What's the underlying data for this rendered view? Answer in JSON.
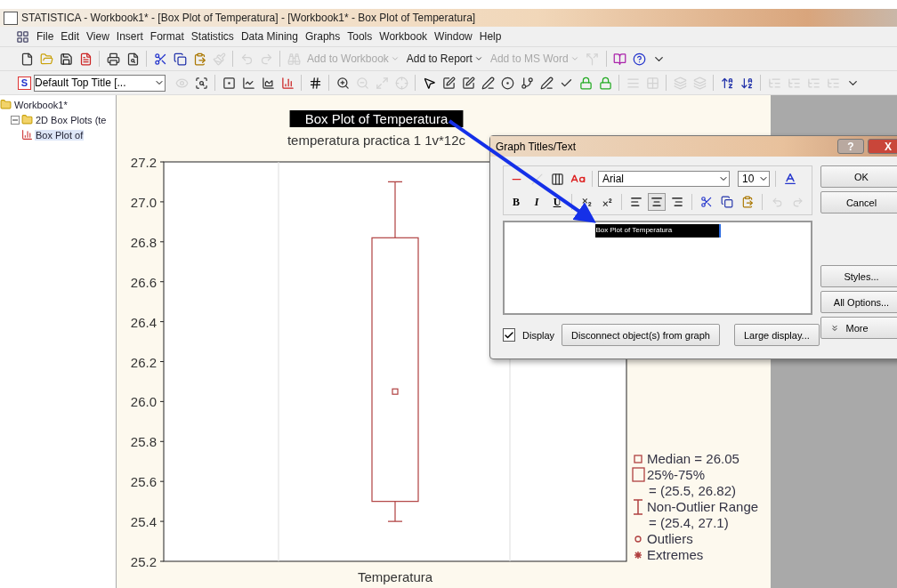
{
  "window": {
    "title": "STATISTICA - Workbook1* - [Box Plot of Temperatura] - [Workbook1* - Box Plot of Temperatura]"
  },
  "menu": [
    "File",
    "Edit",
    "View",
    "Insert",
    "Format",
    "Statistics",
    "Data Mining",
    "Graphs",
    "Tools",
    "Workbook",
    "Window",
    "Help"
  ],
  "toolbar_1": [
    {
      "kind": "new",
      "disabled": false
    },
    {
      "kind": "open",
      "disabled": false
    },
    {
      "kind": "save",
      "disabled": false
    },
    {
      "kind": "pdf",
      "disabled": false
    },
    {
      "kind": "separator"
    },
    {
      "kind": "print",
      "disabled": false
    },
    {
      "kind": "preview",
      "disabled": false
    },
    {
      "kind": "separator"
    },
    {
      "kind": "cut",
      "disabled": false
    },
    {
      "kind": "copy",
      "disabled": false
    },
    {
      "kind": "paste",
      "disabled": false
    },
    {
      "kind": "brush",
      "disabled": true
    },
    {
      "kind": "separator"
    },
    {
      "kind": "undo",
      "disabled": true
    },
    {
      "kind": "redo",
      "disabled": true
    },
    {
      "kind": "separator"
    },
    {
      "kind": "binoculars",
      "disabled": true
    },
    {
      "kind": "text",
      "label": "Add to Workbook",
      "disabled": true
    },
    {
      "kind": "text",
      "label": "Add to Report",
      "disabled": false
    },
    {
      "kind": "text",
      "label": "Add to MS Word",
      "disabled": true
    },
    {
      "kind": "fork",
      "disabled": true
    },
    {
      "kind": "separator"
    },
    {
      "kind": "book",
      "disabled": false
    },
    {
      "kind": "help",
      "disabled": false
    },
    {
      "kind": "more",
      "disabled": false
    }
  ],
  "toolbar_2": [
    {
      "kind": "select",
      "badge": "S",
      "value": "Default Top Title [...",
      "disabled": false
    },
    {
      "kind": "eye",
      "disabled": true
    },
    {
      "kind": "zoom-frame",
      "disabled": false
    },
    {
      "kind": "separator"
    },
    {
      "kind": "box",
      "disabled": false
    },
    {
      "kind": "chart-line",
      "disabled": false
    },
    {
      "kind": "chart-area",
      "disabled": false
    },
    {
      "kind": "chart-bar",
      "disabled": false
    },
    {
      "kind": "separator"
    },
    {
      "kind": "grid",
      "disabled": false
    },
    {
      "kind": "separator"
    },
    {
      "kind": "zoom-in",
      "disabled": false
    },
    {
      "kind": "zoom-out",
      "disabled": true
    },
    {
      "kind": "resize",
      "disabled": true
    },
    {
      "kind": "crosshair",
      "disabled": true
    },
    {
      "kind": "separator"
    },
    {
      "kind": "pointer",
      "disabled": false
    },
    {
      "kind": "edit",
      "disabled": false
    },
    {
      "kind": "edit",
      "disabled": false
    },
    {
      "kind": "pen",
      "disabled": false
    },
    {
      "kind": "circle-pen",
      "disabled": false
    },
    {
      "kind": "branch",
      "disabled": false
    },
    {
      "kind": "pen",
      "disabled": false
    },
    {
      "kind": "check",
      "disabled": false
    },
    {
      "kind": "lock",
      "disabled": false
    },
    {
      "kind": "lock",
      "disabled": false
    },
    {
      "kind": "separator"
    },
    {
      "kind": "lines",
      "disabled": true
    },
    {
      "kind": "pattern",
      "disabled": true
    },
    {
      "kind": "separator"
    },
    {
      "kind": "layers",
      "disabled": true
    },
    {
      "kind": "layers",
      "disabled": true
    },
    {
      "kind": "separator"
    },
    {
      "kind": "font-up",
      "disabled": false
    },
    {
      "kind": "font-down",
      "disabled": false
    },
    {
      "kind": "separator"
    },
    {
      "kind": "indent",
      "disabled": true
    },
    {
      "kind": "indent",
      "disabled": true
    },
    {
      "kind": "indent",
      "disabled": true
    },
    {
      "kind": "indent",
      "disabled": true
    },
    {
      "kind": "more",
      "disabled": false
    }
  ],
  "tree": [
    {
      "label": "Workbook1*",
      "children": [
        {
          "label": "2D Box Plots (te",
          "expanded": true,
          "children": [
            {
              "label": "Box Plot of",
              "selected": true
            }
          ]
        }
      ]
    }
  ],
  "graph": {
    "title": {
      "text": "Box Plot of Temperatura",
      "selected": true
    },
    "subtitle": "temperatura practica 1 1v*12c",
    "y_ticks": [
      "27.2",
      "27.0",
      "26.8",
      "26.6",
      "26.4",
      "26.2",
      "26.0",
      "25.8",
      "25.6",
      "25.4",
      "25.2"
    ],
    "category": "Temperatura",
    "legend": [
      {
        "kind": "median",
        "label": "Median = 26.05"
      },
      {
        "kind": "box",
        "label": "25%-75%",
        "detail": "= (25.5, 26.82)"
      },
      {
        "kind": "whisker",
        "label": "Non-Outlier Range",
        "detail": "= (25.4, 27.1)"
      },
      {
        "kind": "outlier",
        "label": "Outliers"
      },
      {
        "kind": "extreme",
        "label": "Extremes"
      }
    ]
  },
  "dialog": {
    "title": "Graph Titles/Text",
    "help": "?",
    "close": "X",
    "font": "Arial",
    "size": "10",
    "format": [
      {
        "kind": "bold",
        "label": "B"
      },
      {
        "kind": "italic",
        "label": "I"
      },
      {
        "kind": "underline",
        "label": "U"
      }
    ],
    "align": [
      {
        "kind": "left",
        "selected": false
      },
      {
        "kind": "center",
        "selected": true
      },
      {
        "kind": "right",
        "selected": false
      }
    ],
    "text": {
      "value": "Box Plot of Temperatura",
      "selected": true
    },
    "display": {
      "label": "Display",
      "checked": true
    },
    "buttons": [
      "Disconnect object(s) from graph",
      "Large display..."
    ],
    "side_buttons": [
      {
        "label": "OK",
        "kind": "top"
      },
      {
        "label": "Cancel",
        "kind": "top"
      },
      {
        "label": "Styles...",
        "kind": "bottom"
      },
      {
        "label": "All Options...",
        "kind": "bottom"
      },
      {
        "label": "More",
        "kind": "more"
      }
    ]
  }
}
